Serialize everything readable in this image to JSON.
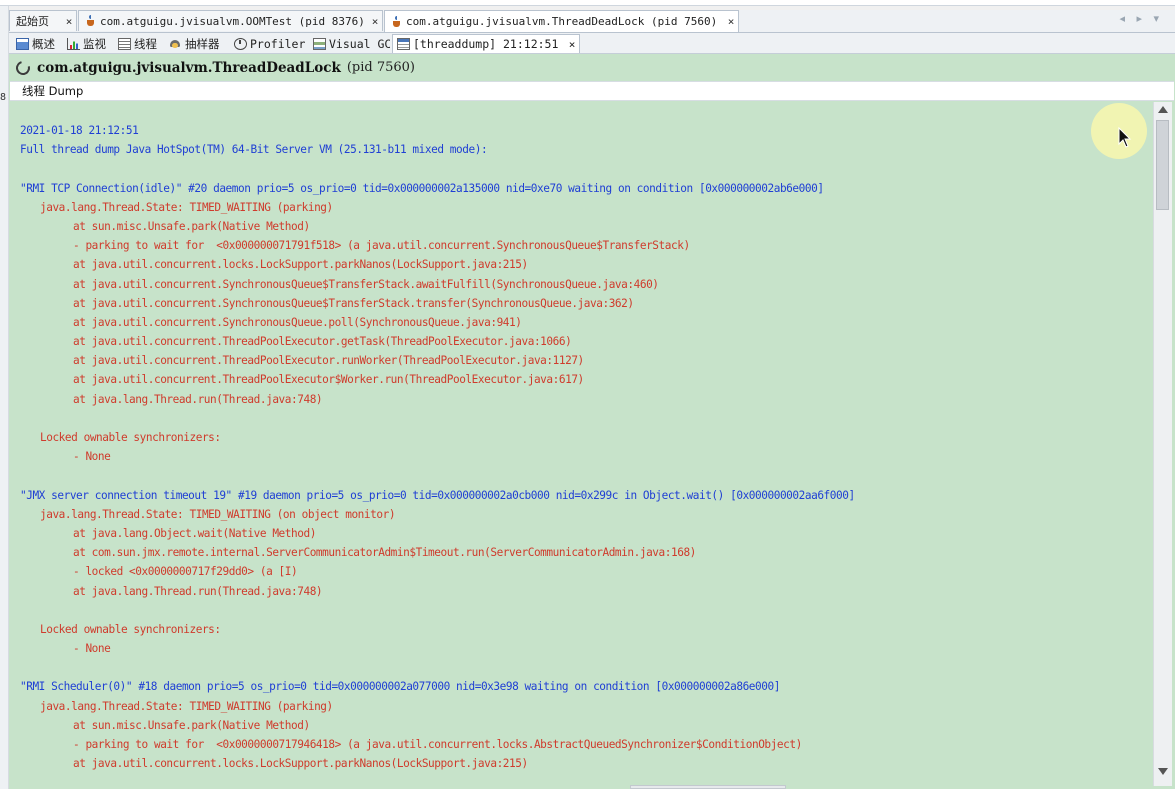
{
  "gutter_mark": "8",
  "tabs": [
    {
      "label": "起始页",
      "close": "×"
    },
    {
      "label": "com.atguigu.jvisualvm.OOMTest (pid 8376)",
      "close": "×"
    },
    {
      "label": "com.atguigu.jvisualvm.ThreadDeadLock (pid 7560)",
      "close": "×",
      "active": true
    }
  ],
  "tab_nav": "◂ ▸ ▾",
  "subtabs": [
    {
      "label": "概述",
      "icon": "overview-icon"
    },
    {
      "label": "监视",
      "icon": "monitor-icon"
    },
    {
      "label": "线程",
      "icon": "threads-icon"
    },
    {
      "label": "抽样器",
      "icon": "sampler-icon"
    },
    {
      "label": "Profiler",
      "icon": "profiler-icon"
    },
    {
      "label": "Visual GC",
      "icon": "visual-gc-icon"
    },
    {
      "label": "[threaddump] 21:12:51",
      "icon": "thread-dump-icon",
      "close": "×",
      "active": true
    }
  ],
  "panel": {
    "app_name": "com.atguigu.jvisualvm.ThreadDeadLock",
    "pid": "(pid 7560)",
    "section_label": "线程 Dump"
  },
  "dump_lines": [
    {
      "text": "2021-01-18 21:12:51",
      "color": "blue",
      "indent": 0
    },
    {
      "text": "Full thread dump Java HotSpot(TM) 64-Bit Server VM (25.131-b11 mixed mode):",
      "color": "blue",
      "indent": 0
    },
    {
      "text": "",
      "indent": 0
    },
    {
      "text": "\"RMI TCP Connection(idle)\" #20 daemon prio=5 os_prio=0 tid=0x000000002a135000 nid=0xe70 waiting on condition [0x000000002ab6e000]",
      "color": "blue",
      "indent": 0
    },
    {
      "text": "java.lang.Thread.State: TIMED_WAITING (parking)",
      "color": "red",
      "indent": 1
    },
    {
      "text": "at sun.misc.Unsafe.park(Native Method)",
      "color": "red",
      "indent": 2
    },
    {
      "text": "- parking to wait for  <0x000000071791f518> (a java.util.concurrent.SynchronousQueue$TransferStack)",
      "color": "red",
      "indent": 2
    },
    {
      "text": "at java.util.concurrent.locks.LockSupport.parkNanos(LockSupport.java:215)",
      "color": "red",
      "indent": 2
    },
    {
      "text": "at java.util.concurrent.SynchronousQueue$TransferStack.awaitFulfill(SynchronousQueue.java:460)",
      "color": "red",
      "indent": 2
    },
    {
      "text": "at java.util.concurrent.SynchronousQueue$TransferStack.transfer(SynchronousQueue.java:362)",
      "color": "red",
      "indent": 2
    },
    {
      "text": "at java.util.concurrent.SynchronousQueue.poll(SynchronousQueue.java:941)",
      "color": "red",
      "indent": 2
    },
    {
      "text": "at java.util.concurrent.ThreadPoolExecutor.getTask(ThreadPoolExecutor.java:1066)",
      "color": "red",
      "indent": 2
    },
    {
      "text": "at java.util.concurrent.ThreadPoolExecutor.runWorker(ThreadPoolExecutor.java:1127)",
      "color": "red",
      "indent": 2
    },
    {
      "text": "at java.util.concurrent.ThreadPoolExecutor$Worker.run(ThreadPoolExecutor.java:617)",
      "color": "red",
      "indent": 2
    },
    {
      "text": "at java.lang.Thread.run(Thread.java:748)",
      "color": "red",
      "indent": 2
    },
    {
      "text": "",
      "indent": 0
    },
    {
      "text": "Locked ownable synchronizers:",
      "color": "red",
      "indent": 1
    },
    {
      "text": "- None",
      "color": "red",
      "indent": 2
    },
    {
      "text": "",
      "indent": 0
    },
    {
      "text": "\"JMX server connection timeout 19\" #19 daemon prio=5 os_prio=0 tid=0x000000002a0cb000 nid=0x299c in Object.wait() [0x000000002aa6f000]",
      "color": "blue",
      "indent": 0
    },
    {
      "text": "java.lang.Thread.State: TIMED_WAITING (on object monitor)",
      "color": "red",
      "indent": 1
    },
    {
      "text": "at java.lang.Object.wait(Native Method)",
      "color": "red",
      "indent": 2
    },
    {
      "text": "at com.sun.jmx.remote.internal.ServerCommunicatorAdmin$Timeout.run(ServerCommunicatorAdmin.java:168)",
      "color": "red",
      "indent": 2
    },
    {
      "text": "- locked <0x0000000717f29dd0> (a [I)",
      "color": "red",
      "indent": 2
    },
    {
      "text": "at java.lang.Thread.run(Thread.java:748)",
      "color": "red",
      "indent": 2
    },
    {
      "text": "",
      "indent": 0
    },
    {
      "text": "Locked ownable synchronizers:",
      "color": "red",
      "indent": 1
    },
    {
      "text": "- None",
      "color": "red",
      "indent": 2
    },
    {
      "text": "",
      "indent": 0
    },
    {
      "text": "\"RMI Scheduler(0)\" #18 daemon prio=5 os_prio=0 tid=0x000000002a077000 nid=0x3e98 waiting on condition [0x000000002a86e000]",
      "color": "blue",
      "indent": 0
    },
    {
      "text": "java.lang.Thread.State: TIMED_WAITING (parking)",
      "color": "red",
      "indent": 1
    },
    {
      "text": "at sun.misc.Unsafe.park(Native Method)",
      "color": "red",
      "indent": 2
    },
    {
      "text": "- parking to wait for  <0x0000000717946418> (a java.util.concurrent.locks.AbstractQueuedSynchronizer$ConditionObject)",
      "color": "red",
      "indent": 2
    },
    {
      "text": "at java.util.concurrent.locks.LockSupport.parkNanos(LockSupport.java:215)",
      "color": "red",
      "indent": 2
    }
  ],
  "colors": {
    "panel_bg": "#c7e3ca",
    "text_blue": "#1f3fd4",
    "text_red": "#cf3b2c"
  }
}
